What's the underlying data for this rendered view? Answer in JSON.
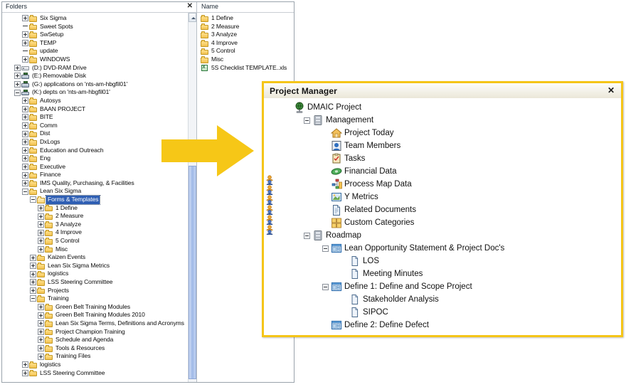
{
  "explorer": {
    "folders_header": "Folders",
    "folders_close_icon": "close-icon",
    "files_header": "Name",
    "scroll_up_icon": "scroll-up-arrow-icon",
    "folder_tree": [
      {
        "label": "Six Sigma",
        "depth": 2,
        "toggle": "plus",
        "icon": "folder"
      },
      {
        "label": "Sweet Spots",
        "depth": 2,
        "toggle": "none",
        "icon": "folder"
      },
      {
        "label": "SwSetup",
        "depth": 2,
        "toggle": "plus",
        "icon": "folder"
      },
      {
        "label": "TEMP",
        "depth": 2,
        "toggle": "plus",
        "icon": "folder"
      },
      {
        "label": "update",
        "depth": 2,
        "toggle": "none",
        "icon": "folder"
      },
      {
        "label": "WINDOWS",
        "depth": 2,
        "toggle": "plus",
        "icon": "folder"
      },
      {
        "label": "(D:) DVD-RAM Drive",
        "depth": 1,
        "toggle": "plus",
        "icon": "drive"
      },
      {
        "label": "(E:) Removable Disk",
        "depth": 1,
        "toggle": "plus",
        "icon": "netdrive"
      },
      {
        "label": "(G:) applications on 'nts-am-hbgfil01'",
        "depth": 1,
        "toggle": "plus",
        "icon": "netdrive"
      },
      {
        "label": "(K:) depts on 'nts-am-hbgfil01'",
        "depth": 1,
        "toggle": "minus",
        "icon": "netdrive"
      },
      {
        "label": "Autosys",
        "depth": 2,
        "toggle": "plus",
        "icon": "folder"
      },
      {
        "label": "BAAN PROJECT",
        "depth": 2,
        "toggle": "plus",
        "icon": "folder"
      },
      {
        "label": "BITE",
        "depth": 2,
        "toggle": "plus",
        "icon": "folder"
      },
      {
        "label": "Comm",
        "depth": 2,
        "toggle": "plus",
        "icon": "folder"
      },
      {
        "label": "Dist",
        "depth": 2,
        "toggle": "plus",
        "icon": "folder"
      },
      {
        "label": "DxLogs",
        "depth": 2,
        "toggle": "plus",
        "icon": "folder"
      },
      {
        "label": "Education and Outreach",
        "depth": 2,
        "toggle": "plus",
        "icon": "folder"
      },
      {
        "label": "Eng",
        "depth": 2,
        "toggle": "plus",
        "icon": "folder"
      },
      {
        "label": "Executive",
        "depth": 2,
        "toggle": "plus",
        "icon": "folder"
      },
      {
        "label": "Finance",
        "depth": 2,
        "toggle": "plus",
        "icon": "folder"
      },
      {
        "label": "IMS Quality, Purchasing, & Facilities",
        "depth": 2,
        "toggle": "plus",
        "icon": "folder"
      },
      {
        "label": "Lean Six Sigma",
        "depth": 2,
        "toggle": "minus",
        "icon": "folder"
      },
      {
        "label": "Forms & Templates",
        "depth": 3,
        "toggle": "minus",
        "icon": "folder-open",
        "selected": true
      },
      {
        "label": "1 Define",
        "depth": 4,
        "toggle": "plus",
        "icon": "folder"
      },
      {
        "label": "2 Measure",
        "depth": 4,
        "toggle": "plus",
        "icon": "folder"
      },
      {
        "label": "3 Analyze",
        "depth": 4,
        "toggle": "plus",
        "icon": "folder"
      },
      {
        "label": "4 Improve",
        "depth": 4,
        "toggle": "plus",
        "icon": "folder"
      },
      {
        "label": "5 Control",
        "depth": 4,
        "toggle": "plus",
        "icon": "folder"
      },
      {
        "label": "Misc",
        "depth": 4,
        "toggle": "plus",
        "icon": "folder"
      },
      {
        "label": "Kaizen Events",
        "depth": 3,
        "toggle": "plus",
        "icon": "folder"
      },
      {
        "label": "Lean Six Sigma Metrics",
        "depth": 3,
        "toggle": "plus",
        "icon": "folder"
      },
      {
        "label": "logistics",
        "depth": 3,
        "toggle": "plus",
        "icon": "folder"
      },
      {
        "label": "LSS Steering Committee",
        "depth": 3,
        "toggle": "plus",
        "icon": "folder"
      },
      {
        "label": "Projects",
        "depth": 3,
        "toggle": "plus",
        "icon": "folder"
      },
      {
        "label": "Training",
        "depth": 3,
        "toggle": "minus",
        "icon": "folder"
      },
      {
        "label": "Green Belt Training Modules",
        "depth": 4,
        "toggle": "plus",
        "icon": "folder"
      },
      {
        "label": "Green Belt Training Modules 2010",
        "depth": 4,
        "toggle": "plus",
        "icon": "folder"
      },
      {
        "label": "Lean Six Sigma Terms, Definitions and Acronyms",
        "depth": 4,
        "toggle": "plus",
        "icon": "folder"
      },
      {
        "label": "Project Champion Training",
        "depth": 4,
        "toggle": "plus",
        "icon": "folder"
      },
      {
        "label": "Schedule and Agenda",
        "depth": 4,
        "toggle": "plus",
        "icon": "folder"
      },
      {
        "label": "Tools & Resources",
        "depth": 4,
        "toggle": "plus",
        "icon": "folder"
      },
      {
        "label": "Training Files",
        "depth": 4,
        "toggle": "plus",
        "icon": "folder"
      },
      {
        "label": "logistics",
        "depth": 2,
        "toggle": "plus",
        "icon": "folder"
      },
      {
        "label": "LSS Steering Committee",
        "depth": 2,
        "toggle": "plus",
        "icon": "folder"
      }
    ],
    "file_list": [
      {
        "label": "1 Define",
        "icon": "folder"
      },
      {
        "label": "2 Measure",
        "icon": "folder"
      },
      {
        "label": "3 Analyze",
        "icon": "folder"
      },
      {
        "label": "4 Improve",
        "icon": "folder"
      },
      {
        "label": "5 Control",
        "icon": "folder"
      },
      {
        "label": "Misc",
        "icon": "folder"
      },
      {
        "label": "5S Checklist TEMPLATE..xls",
        "icon": "excel-file"
      }
    ]
  },
  "arrow": {
    "name": "right-arrow-callout",
    "color": "#f6c717"
  },
  "project_manager": {
    "title": "Project Manager",
    "close_label": "✕",
    "border_color": "#f5c518",
    "tree": [
      {
        "label": "DMAIC Project",
        "depth": 0,
        "toggle": "none",
        "icon": "project-globe-icon"
      },
      {
        "label": "Management",
        "depth": 1,
        "toggle": "minus",
        "icon": "server-icon"
      },
      {
        "label": "Project Today",
        "depth": 2,
        "toggle": "none",
        "icon": "home-icon"
      },
      {
        "label": "Team Members",
        "depth": 2,
        "toggle": "none",
        "icon": "team-icon"
      },
      {
        "label": "Tasks",
        "depth": 2,
        "toggle": "none",
        "icon": "clipboard-icon"
      },
      {
        "label": "Financial Data",
        "depth": 2,
        "toggle": "none",
        "icon": "money-icon"
      },
      {
        "label": "Process Map Data",
        "depth": 2,
        "toggle": "none",
        "icon": "process-map-icon"
      },
      {
        "label": "Y Metrics",
        "depth": 2,
        "toggle": "none",
        "icon": "chart-image-icon"
      },
      {
        "label": "Related Documents",
        "depth": 2,
        "toggle": "none",
        "icon": "document-icon"
      },
      {
        "label": "Custom Categories",
        "depth": 2,
        "toggle": "none",
        "icon": "categories-icon"
      },
      {
        "label": "Roadmap",
        "depth": 1,
        "toggle": "minus",
        "icon": "server-icon"
      },
      {
        "label": "Lean Opportunity Statement & Project Doc's",
        "depth": 2,
        "toggle": "minus",
        "icon": "window-icon"
      },
      {
        "label": "LOS",
        "depth": 3,
        "toggle": "none",
        "icon": "page-icon"
      },
      {
        "label": "Meeting Minutes",
        "depth": 3,
        "toggle": "none",
        "icon": "page-icon"
      },
      {
        "label": "Define 1: Define and Scope Project",
        "depth": 2,
        "toggle": "minus",
        "icon": "window-icon"
      },
      {
        "label": "Stakeholder Analysis",
        "depth": 3,
        "toggle": "none",
        "icon": "page-icon"
      },
      {
        "label": "SIPOC",
        "depth": 3,
        "toggle": "none",
        "icon": "page-icon"
      },
      {
        "label": "Define 2: Define Defect",
        "depth": 2,
        "toggle": "none",
        "icon": "window-icon"
      }
    ],
    "people_markers": {
      "icon": "people-icon",
      "count": 6
    }
  }
}
